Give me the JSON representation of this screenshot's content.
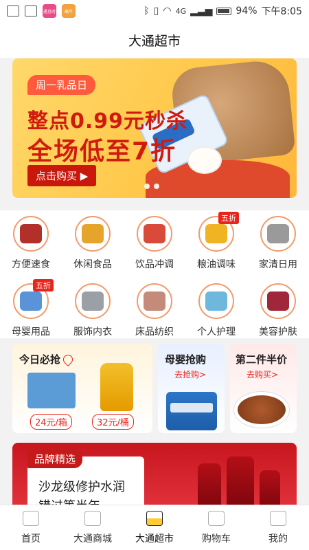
{
  "status_bar": {
    "app1": "遇见时",
    "app2": "高年",
    "network": "4G",
    "battery": "94%",
    "time": "下午8:05"
  },
  "header": {
    "title": "大通超市"
  },
  "banner": {
    "tag": "周一乳品日",
    "line1": "整点0.99元秒杀",
    "line2": "全场低至7折",
    "button": "点击购买 ▶"
  },
  "categories": [
    {
      "label": "方便速食",
      "icon": "instant-food-icon",
      "color": "#b3302a",
      "badge": ""
    },
    {
      "label": "休闲食品",
      "icon": "snacks-icon",
      "color": "#e6a42a",
      "badge": ""
    },
    {
      "label": "饮品冲调",
      "icon": "beverage-icon",
      "color": "#d94a3b",
      "badge": ""
    },
    {
      "label": "粮油调味",
      "icon": "oil-icon",
      "color": "#f0b323",
      "badge": "五折"
    },
    {
      "label": "家清日用",
      "icon": "cleaning-icon",
      "color": "#9a9a9a",
      "badge": ""
    },
    {
      "label": "母婴用品",
      "icon": "baby-icon",
      "color": "#5a93d8",
      "badge": "五折"
    },
    {
      "label": "服饰内衣",
      "icon": "clothing-icon",
      "color": "#9aa0a6",
      "badge": ""
    },
    {
      "label": "床品纺织",
      "icon": "bedding-icon",
      "color": "#c58b7a",
      "badge": ""
    },
    {
      "label": "个人护理",
      "icon": "personal-care-icon",
      "color": "#6fb8dd",
      "badge": ""
    },
    {
      "label": "美容护肤",
      "icon": "beauty-icon",
      "color": "#a0263a",
      "badge": ""
    }
  ],
  "promo": {
    "today": {
      "title": "今日必抢",
      "price1": "24元/箱",
      "price2": "32元/桶"
    },
    "baby": {
      "title": "母婴抢购",
      "link": "去抢购>"
    },
    "half": {
      "title": "第二件半价",
      "link": "去购买>"
    }
  },
  "brand": {
    "tag": "品牌精选",
    "line1": "沙龙级修护水润",
    "line2": "错过等半年"
  },
  "tabbar": [
    {
      "label": "首页",
      "icon": "home-icon",
      "active": false
    },
    {
      "label": "大通商城",
      "icon": "mall-icon",
      "active": false
    },
    {
      "label": "大通超市",
      "icon": "supermarket-icon",
      "active": true
    },
    {
      "label": "购物车",
      "icon": "cart-icon",
      "active": false
    },
    {
      "label": "我的",
      "icon": "profile-icon",
      "active": false
    }
  ]
}
